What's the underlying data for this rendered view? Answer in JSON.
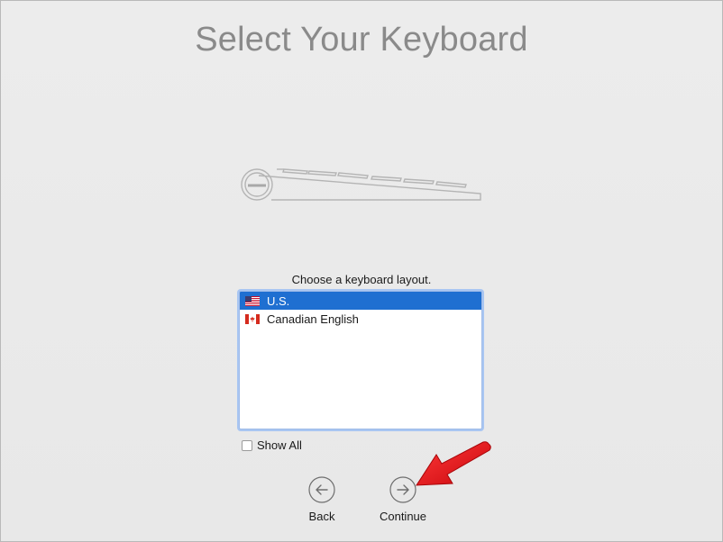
{
  "page": {
    "title": "Select Your Keyboard",
    "prompt": "Choose a keyboard layout."
  },
  "layouts": {
    "items": [
      {
        "label": "U.S.",
        "flag": "us-flag-icon",
        "selected": true
      },
      {
        "label": "Canadian English",
        "flag": "canada-flag-icon",
        "selected": false
      }
    ]
  },
  "show_all": {
    "label": "Show All",
    "checked": false
  },
  "navigation": {
    "back_label": "Back",
    "continue_label": "Continue"
  },
  "colors": {
    "selection": "#1f6fd1",
    "annotation_arrow": "#e8141b",
    "title_text": "#8a8a8a"
  }
}
